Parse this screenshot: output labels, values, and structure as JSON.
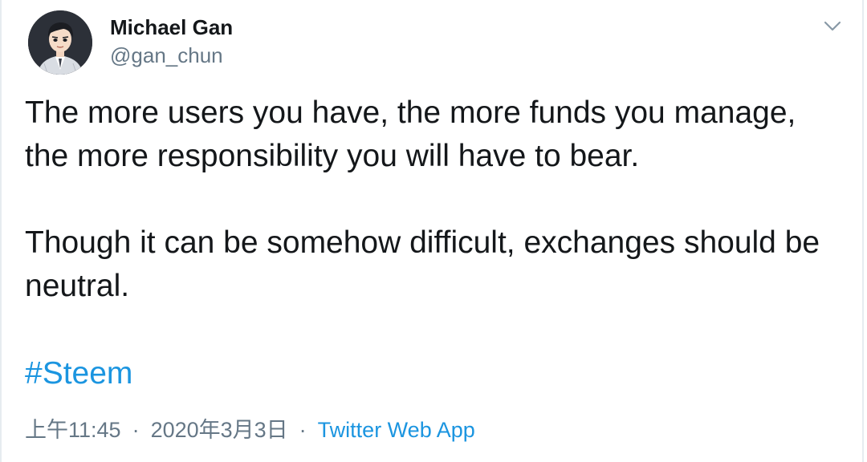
{
  "author": {
    "name": "Michael Gan",
    "handle": "@gan_chun"
  },
  "tweet": {
    "paragraphs": [
      "The more users you have, the more funds you manage,",
      "the more responsibility you will have to bear.",
      "Though it can be somehow difficult, exchanges should be",
      "neutral."
    ],
    "hashtag": "#Steem"
  },
  "meta": {
    "time": "上午11:45",
    "date": "2020年3月3日",
    "separator": "·",
    "source": "Twitter Web App"
  },
  "colors": {
    "link": "#1b95e0",
    "secondary_text": "#657786",
    "primary_text": "#14171a",
    "border": "#e6ecf0"
  },
  "icons": {
    "caret": "chevron-down-icon"
  }
}
